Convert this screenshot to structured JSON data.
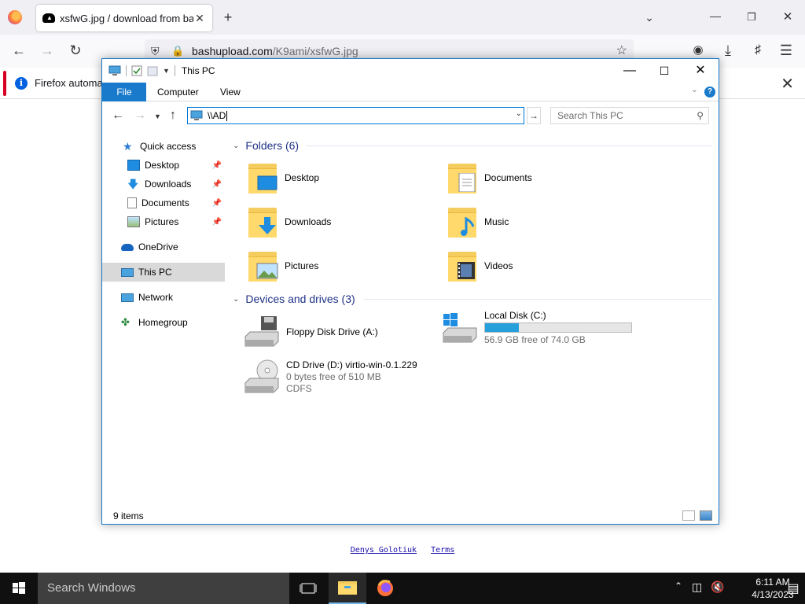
{
  "browser": {
    "tab_title": "xsfwG.jpg / download from bas",
    "url_domain": "bashupload.com",
    "url_path": "/K9ami/xsfwG.jpg",
    "notification_text": "Firefox automati"
  },
  "page_footer": {
    "author_link": "Denys Golotiuk",
    "terms_link": "Terms"
  },
  "explorer": {
    "title": "This PC",
    "ribbon_tabs": [
      "File",
      "Computer",
      "View"
    ],
    "address_value": "\\\\AD",
    "search_placeholder": "Search This PC",
    "nav": {
      "quick_access": "Quick access",
      "desktop": "Desktop",
      "downloads": "Downloads",
      "documents": "Documents",
      "pictures": "Pictures",
      "onedrive": "OneDrive",
      "this_pc": "This PC",
      "network": "Network",
      "homegroup": "Homegroup"
    },
    "folders_header": "Folders (6)",
    "folders": [
      "Desktop",
      "Documents",
      "Downloads",
      "Music",
      "Pictures",
      "Videos"
    ],
    "drives_header": "Devices and drives (3)",
    "drives": {
      "floppy": {
        "name": "Floppy Disk Drive (A:)"
      },
      "local": {
        "name": "Local Disk (C:)",
        "free_text": "56.9 GB free of 74.0 GB",
        "used_fraction": 0.23
      },
      "cd": {
        "name": "CD Drive (D:) virtio-win-0.1.229",
        "free_text": "0 bytes free of 510 MB",
        "fs": "CDFS"
      }
    },
    "status_items": "9 items"
  },
  "taskbar": {
    "search_placeholder": "Search Windows",
    "time": "6:11 AM",
    "date": "4/13/2023"
  },
  "colors": {
    "accent": "#1979ca",
    "folder_yellow": "#ffd96b",
    "drive_bar": "#26a0da",
    "taskbar": "#101010"
  }
}
